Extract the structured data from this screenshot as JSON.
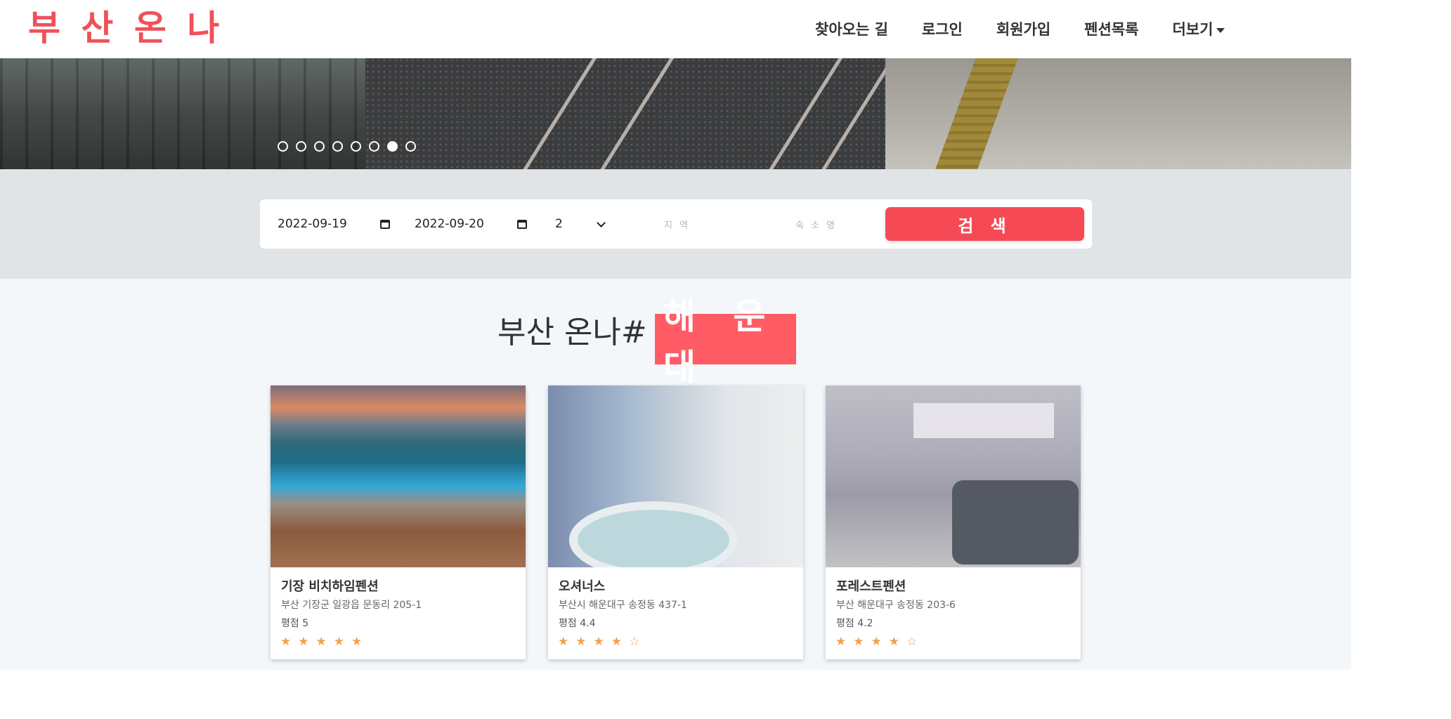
{
  "header": {
    "logo": "부 산 온 나",
    "nav": [
      {
        "label": "찾아오는 길"
      },
      {
        "label": "로그인"
      },
      {
        "label": "회원가입"
      },
      {
        "label": "펜션목록"
      },
      {
        "label": "더보기"
      }
    ]
  },
  "hero": {
    "slide_count": 8,
    "active_slide": 7
  },
  "search": {
    "checkin": "2022-09-19",
    "checkout": "2022-09-20",
    "guests": "2",
    "region_placeholder": "지 역",
    "lodging_placeholder": "숙 소 명",
    "button_label": "검 색"
  },
  "section": {
    "title": "부산 온나#",
    "highlight": "해 운 대"
  },
  "cards": [
    {
      "name": "기장 비치하임펜션",
      "address": "부산 기장군 일광읍 문동리 205-1",
      "rating_label": "평점 5",
      "rating": 5
    },
    {
      "name": "오셔너스",
      "address": "부산시 해운대구 송정동 437-1",
      "rating_label": "평점 4.4",
      "rating": 4.4
    },
    {
      "name": "포레스트펜션",
      "address": "부산 해운대구 송정동 203-6",
      "rating_label": "평점 4.2",
      "rating": 4.2
    }
  ],
  "colors": {
    "brand": "#f0505a",
    "button": "#f54a55",
    "highlight": "#ff5c66",
    "star": "#f5a04a"
  }
}
